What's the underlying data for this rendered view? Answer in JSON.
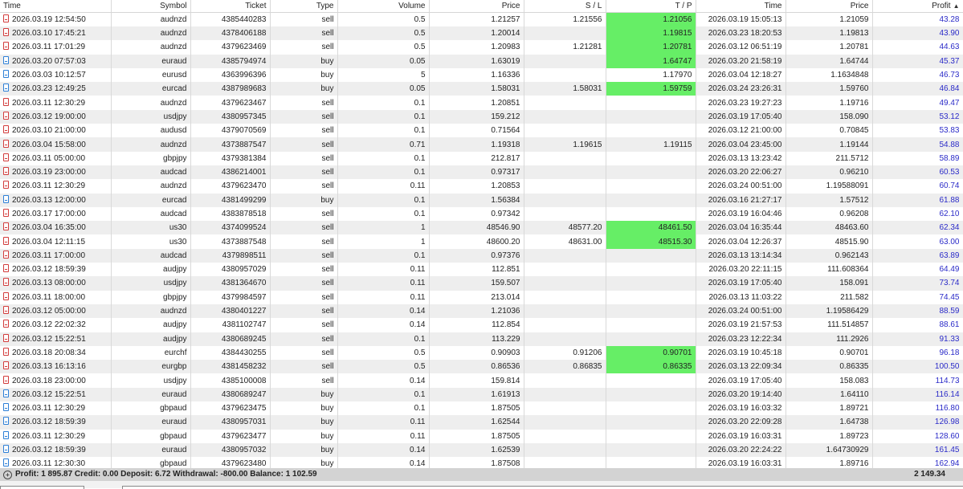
{
  "headers": {
    "open_time": "Time",
    "symbol": "Symbol",
    "ticket": "Ticket",
    "type": "Type",
    "volume": "Volume",
    "open_price": "Price",
    "sl": "S / L",
    "tp": "T / P",
    "close_time": "Time",
    "close_price": "Price",
    "profit": "Profit"
  },
  "rows": [
    {
      "open_time": "2026.03.19 12:54:50",
      "symbol": "audnzd",
      "ticket": "4385440283",
      "type": "sell",
      "volume": "0.5",
      "open_price": "1.21257",
      "sl": "1.21556",
      "tp": "1.21056",
      "tp_hit": true,
      "close_time": "2026.03.19 15:05:13",
      "close_price": "1.21059",
      "profit": "43.28"
    },
    {
      "open_time": "2026.03.10 17:45:21",
      "symbol": "audnzd",
      "ticket": "4378406188",
      "type": "sell",
      "volume": "0.5",
      "open_price": "1.20014",
      "sl": "",
      "tp": "1.19815",
      "tp_hit": true,
      "close_time": "2026.03.23 18:20:53",
      "close_price": "1.19813",
      "profit": "43.90"
    },
    {
      "open_time": "2026.03.11 17:01:29",
      "symbol": "audnzd",
      "ticket": "4379623469",
      "type": "sell",
      "volume": "0.5",
      "open_price": "1.20983",
      "sl": "1.21281",
      "tp": "1.20781",
      "tp_hit": true,
      "close_time": "2026.03.12 06:51:19",
      "close_price": "1.20781",
      "profit": "44.63"
    },
    {
      "open_time": "2026.03.20 07:57:03",
      "symbol": "euraud",
      "ticket": "4385794974",
      "type": "buy",
      "volume": "0.05",
      "open_price": "1.63019",
      "sl": "",
      "tp": "1.64747",
      "tp_hit": true,
      "close_time": "2026.03.20 21:58:19",
      "close_price": "1.64744",
      "profit": "45.37"
    },
    {
      "open_time": "2026.03.03 10:12:57",
      "symbol": "eurusd",
      "ticket": "4363996396",
      "type": "buy",
      "volume": "5",
      "open_price": "1.16336",
      "sl": "",
      "tp": "1.17970",
      "tp_hit": false,
      "close_time": "2026.03.04 12:18:27",
      "close_price": "1.1634848",
      "profit": "46.73"
    },
    {
      "open_time": "2026.03.23 12:49:25",
      "symbol": "eurcad",
      "ticket": "4387989683",
      "type": "buy",
      "volume": "0.05",
      "open_price": "1.58031",
      "sl": "1.58031",
      "tp": "1.59759",
      "tp_hit": true,
      "close_time": "2026.03.24 23:26:31",
      "close_price": "1.59760",
      "profit": "46.84"
    },
    {
      "open_time": "2026.03.11 12:30:29",
      "symbol": "audnzd",
      "ticket": "4379623467",
      "type": "sell",
      "volume": "0.1",
      "open_price": "1.20851",
      "sl": "",
      "tp": "",
      "tp_hit": false,
      "close_time": "2026.03.23 19:27:23",
      "close_price": "1.19716",
      "profit": "49.47"
    },
    {
      "open_time": "2026.03.12 19:00:00",
      "symbol": "usdjpy",
      "ticket": "4380957345",
      "type": "sell",
      "volume": "0.1",
      "open_price": "159.212",
      "sl": "",
      "tp": "",
      "tp_hit": false,
      "close_time": "2026.03.19 17:05:40",
      "close_price": "158.090",
      "profit": "53.12"
    },
    {
      "open_time": "2026.03.10 21:00:00",
      "symbol": "audusd",
      "ticket": "4379070569",
      "type": "sell",
      "volume": "0.1",
      "open_price": "0.71564",
      "sl": "",
      "tp": "",
      "tp_hit": false,
      "close_time": "2026.03.12 21:00:00",
      "close_price": "0.70845",
      "profit": "53.83"
    },
    {
      "open_time": "2026.03.04 15:58:00",
      "symbol": "audnzd",
      "ticket": "4373887547",
      "type": "sell",
      "volume": "0.71",
      "open_price": "1.19318",
      "sl": "1.19615",
      "tp": "1.19115",
      "tp_hit": false,
      "close_time": "2026.03.04 23:45:00",
      "close_price": "1.19144",
      "profit": "54.88"
    },
    {
      "open_time": "2026.03.11 05:00:00",
      "symbol": "gbpjpy",
      "ticket": "4379381384",
      "type": "sell",
      "volume": "0.1",
      "open_price": "212.817",
      "sl": "",
      "tp": "",
      "tp_hit": false,
      "close_time": "2026.03.13 13:23:42",
      "close_price": "211.5712",
      "profit": "58.89"
    },
    {
      "open_time": "2026.03.19 23:00:00",
      "symbol": "audcad",
      "ticket": "4386214001",
      "type": "sell",
      "volume": "0.1",
      "open_price": "0.97317",
      "sl": "",
      "tp": "",
      "tp_hit": false,
      "close_time": "2026.03.20 22:06:27",
      "close_price": "0.96210",
      "profit": "60.53"
    },
    {
      "open_time": "2026.03.11 12:30:29",
      "symbol": "audnzd",
      "ticket": "4379623470",
      "type": "sell",
      "volume": "0.11",
      "open_price": "1.20853",
      "sl": "",
      "tp": "",
      "tp_hit": false,
      "close_time": "2026.03.24 00:51:00",
      "close_price": "1.19588091",
      "profit": "60.74"
    },
    {
      "open_time": "2026.03.13 12:00:00",
      "symbol": "eurcad",
      "ticket": "4381499299",
      "type": "buy",
      "volume": "0.1",
      "open_price": "1.56384",
      "sl": "",
      "tp": "",
      "tp_hit": false,
      "close_time": "2026.03.16 21:27:17",
      "close_price": "1.57512",
      "profit": "61.88"
    },
    {
      "open_time": "2026.03.17 17:00:00",
      "symbol": "audcad",
      "ticket": "4383878518",
      "type": "sell",
      "volume": "0.1",
      "open_price": "0.97342",
      "sl": "",
      "tp": "",
      "tp_hit": false,
      "close_time": "2026.03.19 16:04:46",
      "close_price": "0.96208",
      "profit": "62.10"
    },
    {
      "open_time": "2026.03.04 16:35:00",
      "symbol": "us30",
      "ticket": "4374099524",
      "type": "sell",
      "volume": "1",
      "open_price": "48546.90",
      "sl": "48577.20",
      "tp": "48461.50",
      "tp_hit": true,
      "close_time": "2026.03.04 16:35:44",
      "close_price": "48463.60",
      "profit": "62.34"
    },
    {
      "open_time": "2026.03.04 12:11:15",
      "symbol": "us30",
      "ticket": "4373887548",
      "type": "sell",
      "volume": "1",
      "open_price": "48600.20",
      "sl": "48631.00",
      "tp": "48515.30",
      "tp_hit": true,
      "close_time": "2026.03.04 12:26:37",
      "close_price": "48515.90",
      "profit": "63.00"
    },
    {
      "open_time": "2026.03.11 17:00:00",
      "symbol": "audcad",
      "ticket": "4379898511",
      "type": "sell",
      "volume": "0.1",
      "open_price": "0.97376",
      "sl": "",
      "tp": "",
      "tp_hit": false,
      "close_time": "2026.03.13 13:14:34",
      "close_price": "0.962143",
      "profit": "63.89"
    },
    {
      "open_time": "2026.03.12 18:59:39",
      "symbol": "audjpy",
      "ticket": "4380957029",
      "type": "sell",
      "volume": "0.11",
      "open_price": "112.851",
      "sl": "",
      "tp": "",
      "tp_hit": false,
      "close_time": "2026.03.20 22:11:15",
      "close_price": "111.608364",
      "profit": "64.49"
    },
    {
      "open_time": "2026.03.13 08:00:00",
      "symbol": "usdjpy",
      "ticket": "4381364670",
      "type": "sell",
      "volume": "0.11",
      "open_price": "159.507",
      "sl": "",
      "tp": "",
      "tp_hit": false,
      "close_time": "2026.03.19 17:05:40",
      "close_price": "158.091",
      "profit": "73.74"
    },
    {
      "open_time": "2026.03.11 18:00:00",
      "symbol": "gbpjpy",
      "ticket": "4379984597",
      "type": "sell",
      "volume": "0.11",
      "open_price": "213.014",
      "sl": "",
      "tp": "",
      "tp_hit": false,
      "close_time": "2026.03.13 11:03:22",
      "close_price": "211.582",
      "profit": "74.45"
    },
    {
      "open_time": "2026.03.12 05:00:00",
      "symbol": "audnzd",
      "ticket": "4380401227",
      "type": "sell",
      "volume": "0.14",
      "open_price": "1.21036",
      "sl": "",
      "tp": "",
      "tp_hit": false,
      "close_time": "2026.03.24 00:51:00",
      "close_price": "1.19586429",
      "profit": "88.59"
    },
    {
      "open_time": "2026.03.12 22:02:32",
      "symbol": "audjpy",
      "ticket": "4381102747",
      "type": "sell",
      "volume": "0.14",
      "open_price": "112.854",
      "sl": "",
      "tp": "",
      "tp_hit": false,
      "close_time": "2026.03.19 21:57:53",
      "close_price": "111.514857",
      "profit": "88.61"
    },
    {
      "open_time": "2026.03.12 15:22:51",
      "symbol": "audjpy",
      "ticket": "4380689245",
      "type": "sell",
      "volume": "0.1",
      "open_price": "113.229",
      "sl": "",
      "tp": "",
      "tp_hit": false,
      "close_time": "2026.03.23 12:22:34",
      "close_price": "111.2926",
      "profit": "91.33"
    },
    {
      "open_time": "2026.03.18 20:08:34",
      "symbol": "eurchf",
      "ticket": "4384430255",
      "type": "sell",
      "volume": "0.5",
      "open_price": "0.90903",
      "sl": "0.91206",
      "tp": "0.90701",
      "tp_hit": true,
      "close_time": "2026.03.19 10:45:18",
      "close_price": "0.90701",
      "profit": "96.18"
    },
    {
      "open_time": "2026.03.13 16:13:16",
      "symbol": "eurgbp",
      "ticket": "4381458232",
      "type": "sell",
      "volume": "0.5",
      "open_price": "0.86536",
      "sl": "0.86835",
      "tp": "0.86335",
      "tp_hit": true,
      "close_time": "2026.03.13 22:09:34",
      "close_price": "0.86335",
      "profit": "100.50"
    },
    {
      "open_time": "2026.03.18 23:00:00",
      "symbol": "usdjpy",
      "ticket": "4385100008",
      "type": "sell",
      "volume": "0.14",
      "open_price": "159.814",
      "sl": "",
      "tp": "",
      "tp_hit": false,
      "close_time": "2026.03.19 17:05:40",
      "close_price": "158.083",
      "profit": "114.73"
    },
    {
      "open_time": "2026.03.12 15:22:51",
      "symbol": "euraud",
      "ticket": "4380689247",
      "type": "buy",
      "volume": "0.1",
      "open_price": "1.61913",
      "sl": "",
      "tp": "",
      "tp_hit": false,
      "close_time": "2026.03.20 19:14:40",
      "close_price": "1.64110",
      "profit": "116.14"
    },
    {
      "open_time": "2026.03.11 12:30:29",
      "symbol": "gbpaud",
      "ticket": "4379623475",
      "type": "buy",
      "volume": "0.1",
      "open_price": "1.87505",
      "sl": "",
      "tp": "",
      "tp_hit": false,
      "close_time": "2026.03.19 16:03:32",
      "close_price": "1.89721",
      "profit": "116.80"
    },
    {
      "open_time": "2026.03.12 18:59:39",
      "symbol": "euraud",
      "ticket": "4380957031",
      "type": "buy",
      "volume": "0.11",
      "open_price": "1.62544",
      "sl": "",
      "tp": "",
      "tp_hit": false,
      "close_time": "2026.03.20 22:09:28",
      "close_price": "1.64738",
      "profit": "126.98"
    },
    {
      "open_time": "2026.03.11 12:30:29",
      "symbol": "gbpaud",
      "ticket": "4379623477",
      "type": "buy",
      "volume": "0.11",
      "open_price": "1.87505",
      "sl": "",
      "tp": "",
      "tp_hit": false,
      "close_time": "2026.03.19 16:03:31",
      "close_price": "1.89723",
      "profit": "128.60"
    },
    {
      "open_time": "2026.03.12 18:59:39",
      "symbol": "euraud",
      "ticket": "4380957032",
      "type": "buy",
      "volume": "0.14",
      "open_price": "1.62539",
      "sl": "",
      "tp": "",
      "tp_hit": false,
      "close_time": "2026.03.20 22:24:22",
      "close_price": "1.64730929",
      "profit": "161.45"
    },
    {
      "open_time": "2026.03.11 12:30:30",
      "symbol": "gbpaud",
      "ticket": "4379623480",
      "type": "buy",
      "volume": "0.14",
      "open_price": "1.87508",
      "sl": "",
      "tp": "",
      "tp_hit": false,
      "close_time": "2026.03.19 16:03:31",
      "close_price": "1.89716",
      "profit": "162.94"
    }
  ],
  "summary": {
    "text": "Profit: 1 895.87  Credit: 0.00  Deposit: 6.72  Withdrawal: -800.00  Balance: 1 102.59",
    "total": "2 149.34"
  },
  "colors": {
    "tp_hit_background": "#66ee66",
    "profit_text": "#2b2bc8",
    "sell_icon": "#d23c3c",
    "buy_icon": "#2d7fd6"
  }
}
